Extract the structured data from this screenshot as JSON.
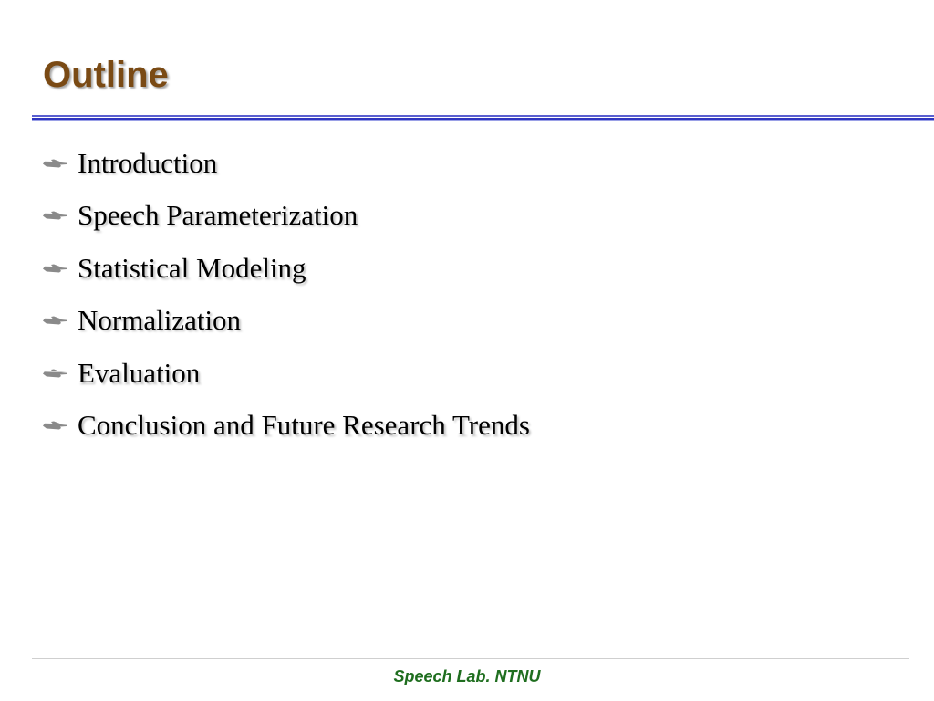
{
  "slide": {
    "title": "Outline",
    "bullet_icon": "pointing-hand-icon",
    "items": [
      {
        "label": "Introduction"
      },
      {
        "label": "Speech Parameterization"
      },
      {
        "label": "Statistical Modeling"
      },
      {
        "label": "Normalization"
      },
      {
        "label": "Evaluation"
      },
      {
        "label": "Conclusion and Future Research Trends"
      }
    ],
    "footer": "Speech Lab. NTNU"
  },
  "colors": {
    "title": "#7a4a14",
    "rule": "#2f35c0",
    "footer": "#1f6e1f"
  }
}
